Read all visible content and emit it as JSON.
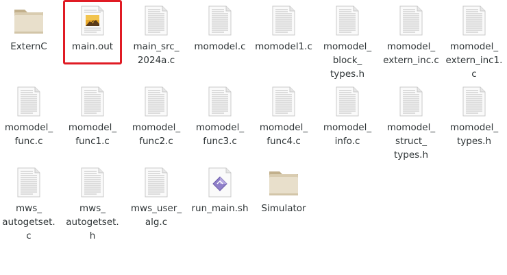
{
  "files": [
    {
      "label": "ExternC",
      "icon": "folder-icon"
    },
    {
      "label": "main.out",
      "icon": "image-document-icon",
      "selected": true
    },
    {
      "label": "main_src_\n2024a.c",
      "icon": "text-document-icon"
    },
    {
      "label": "momodel.c",
      "icon": "text-document-icon"
    },
    {
      "label": "momodel1.c",
      "icon": "text-document-icon"
    },
    {
      "label": "momodel_\nblock_\ntypes.h",
      "icon": "text-document-icon"
    },
    {
      "label": "momodel_\nextern_inc.c",
      "icon": "text-document-icon"
    },
    {
      "label": "momodel_\nextern_inc1.\nc",
      "icon": "text-document-icon"
    },
    {
      "label": "momodel_\nfunc.c",
      "icon": "text-document-icon"
    },
    {
      "label": "momodel_\nfunc1.c",
      "icon": "text-document-icon"
    },
    {
      "label": "momodel_\nfunc2.c",
      "icon": "text-document-icon"
    },
    {
      "label": "momodel_\nfunc3.c",
      "icon": "text-document-icon"
    },
    {
      "label": "momodel_\nfunc4.c",
      "icon": "text-document-icon"
    },
    {
      "label": "momodel_\ninfo.c",
      "icon": "text-document-icon"
    },
    {
      "label": "momodel_\nstruct_\ntypes.h",
      "icon": "text-document-icon"
    },
    {
      "label": "momodel_\ntypes.h",
      "icon": "text-document-icon"
    },
    {
      "label": "mws_\nautogetset.\nc",
      "icon": "text-document-icon"
    },
    {
      "label": "mws_\nautogetset.\nh",
      "icon": "text-document-icon"
    },
    {
      "label": "mws_user_\nalg.c",
      "icon": "text-document-icon"
    },
    {
      "label": "run_main.sh",
      "icon": "script-icon"
    },
    {
      "label": "Simulator",
      "icon": "folder-icon"
    }
  ],
  "colors": {
    "selection_border": "#e01b24",
    "label_text": "#2e3436",
    "folder_body": "#e6dbc4",
    "folder_tab": "#cdbd9c"
  }
}
